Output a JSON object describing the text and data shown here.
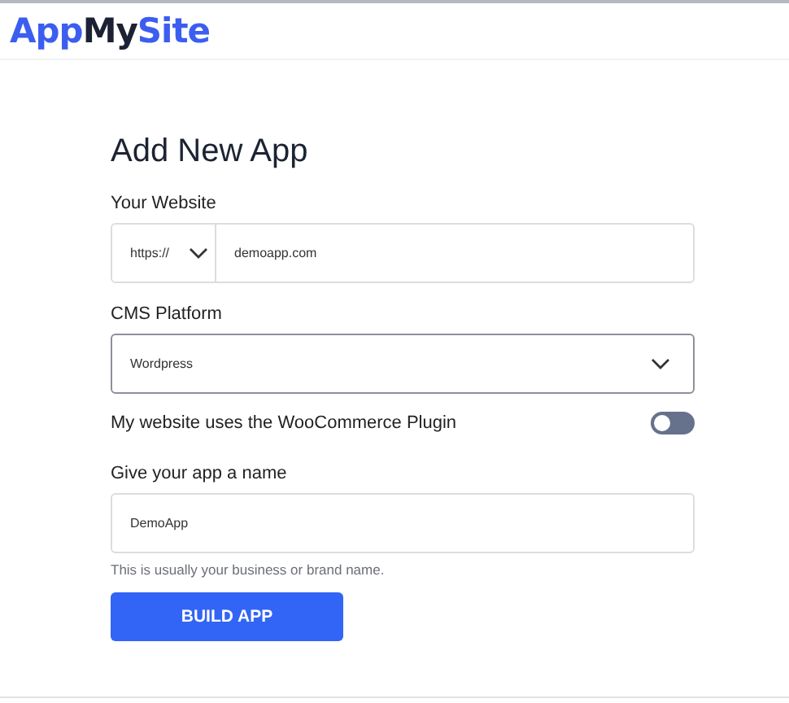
{
  "logo": [
    {
      "text": "App",
      "kind": "accent"
    },
    {
      "text": "My",
      "kind": "plain"
    },
    {
      "text": "Site",
      "kind": "accent"
    }
  ],
  "title": "Add New App",
  "fields": [
    {
      "kind": "url",
      "label": "Your Website",
      "protocol": "https://",
      "value": "demoapp.com"
    },
    {
      "kind": "select",
      "label": "CMS Platform",
      "value": "Wordpress"
    },
    {
      "kind": "toggle",
      "label": "My website uses the WooCommerce Plugin",
      "on": false
    },
    {
      "kind": "text",
      "label": "Give your app a name",
      "value": "DemoApp",
      "hint": "This is usually your business or brand name."
    }
  ],
  "button": "BUILD APP"
}
